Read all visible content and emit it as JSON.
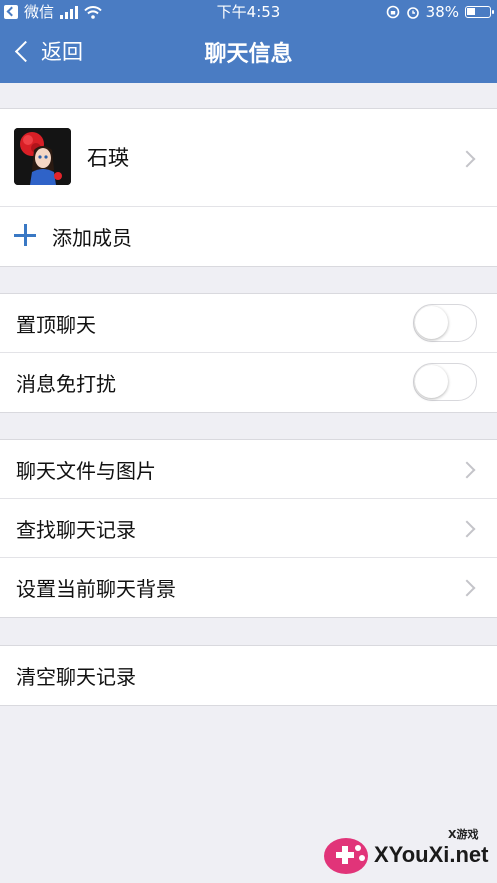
{
  "status_bar": {
    "carrier": "微信",
    "time": "下午4:53",
    "battery": "38%",
    "battery_level": 0.38
  },
  "nav": {
    "back_label": "返回",
    "title": "聊天信息"
  },
  "member": {
    "name": "石瑛",
    "add_label": "添加成员"
  },
  "settings": {
    "pin_chat": "置顶聊天",
    "pin_chat_on": false,
    "mute": "消息免打扰",
    "mute_on": false
  },
  "menu": {
    "files": "聊天文件与图片",
    "search": "查找聊天记录",
    "background": "设置当前聊天背景"
  },
  "clear": {
    "label": "清空聊天记录"
  },
  "watermark": {
    "text": "XYouXi.net",
    "small": "X游戏"
  },
  "colors": {
    "header": "#4a7cc3",
    "accent": "#3a78c4",
    "background": "#efeff4"
  }
}
